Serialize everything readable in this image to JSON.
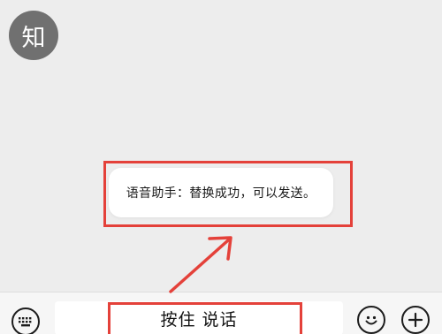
{
  "chat": {
    "avatar_text": "知",
    "avatar_color": "#707070"
  },
  "toast": {
    "message": "语音助手：替换成功，可以发送。"
  },
  "input_bar": {
    "hold_to_talk_label": "按住 说话",
    "keyboard_icon": "keyboard-icon",
    "emoji_icon": "emoji-icon",
    "plus_icon": "plus-icon"
  },
  "annotations": {
    "highlight_color": "#e4413a"
  }
}
